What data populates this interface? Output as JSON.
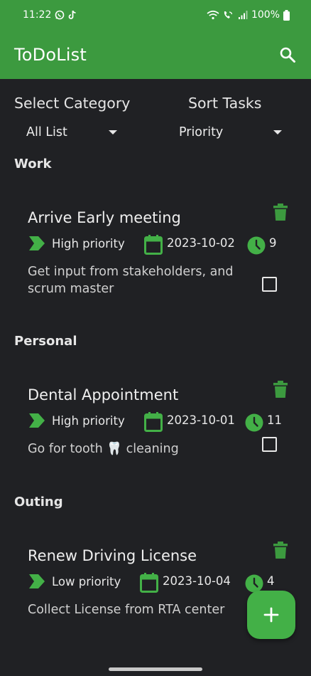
{
  "status_bar": {
    "time": "11:22",
    "battery": "100%"
  },
  "app_bar": {
    "title": "ToDoList"
  },
  "filters": {
    "category_label": "Select Category",
    "category_value": "All List",
    "sort_label": "Sort Tasks",
    "sort_value": "Priority"
  },
  "sections": [
    {
      "title": "Work",
      "task": {
        "title": "Arrive Early meeting",
        "priority": "High priority",
        "date": "2023-10-02",
        "duration": "9",
        "description": "Get input from stakeholders, and scrum master",
        "checked": false
      }
    },
    {
      "title": "Personal",
      "task": {
        "title": "Dental Appointment",
        "priority": "High priority",
        "date": "2023-10-01",
        "duration": "11",
        "description": "Go for tooth 🦷 cleaning",
        "checked": false
      }
    },
    {
      "title": "Outing",
      "task": {
        "title": "Renew Driving License",
        "priority": "Low priority",
        "date": "2023-10-04",
        "duration": "4",
        "description": "Collect License from RTA center",
        "checked": false
      }
    }
  ],
  "colors": {
    "accent": "#3c9a3f",
    "fab": "#43b047",
    "background": "#202124"
  }
}
